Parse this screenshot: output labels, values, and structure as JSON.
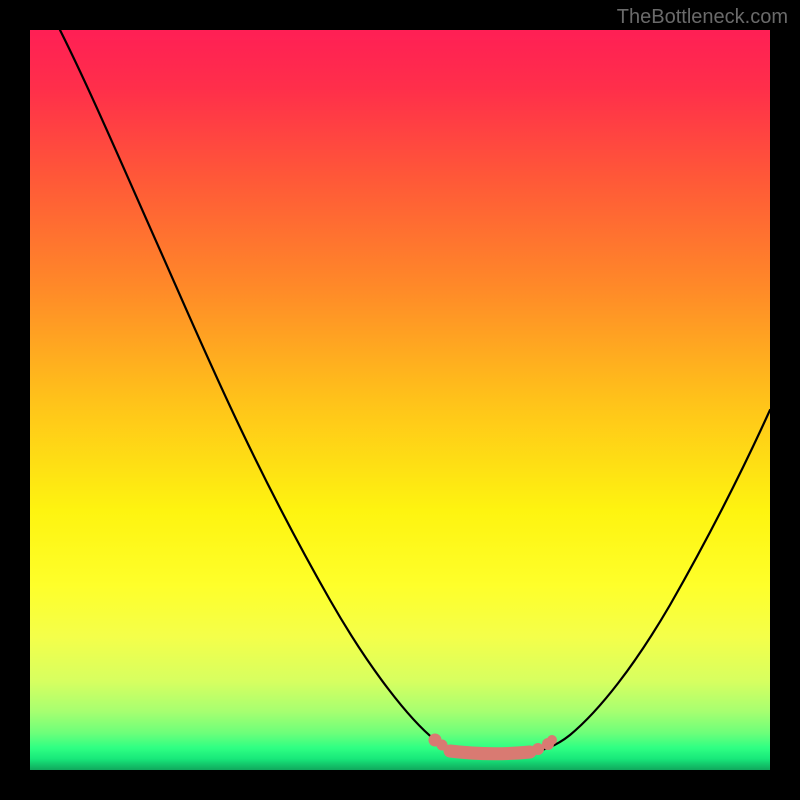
{
  "watermark": "TheBottleneck.com",
  "chart_data": {
    "type": "line",
    "title": "",
    "xlabel": "",
    "ylabel": "",
    "xlim": [
      0,
      100
    ],
    "ylim": [
      0,
      100
    ],
    "grid": false,
    "legend": false,
    "x": [
      4,
      10,
      20,
      30,
      40,
      48,
      52,
      55,
      58,
      60,
      63,
      67,
      72,
      77,
      80,
      85,
      90,
      95,
      100
    ],
    "values": [
      100,
      88,
      68,
      48,
      28,
      12,
      6,
      3,
      2,
      2,
      2,
      3,
      6,
      12,
      17,
      25,
      34,
      43,
      52
    ],
    "background_gradient_stops": [
      {
        "pos": 0,
        "color": "#ff1f55"
      },
      {
        "pos": 50,
        "color": "#ffc21a"
      },
      {
        "pos": 75,
        "color": "#feff2a"
      },
      {
        "pos": 100,
        "color": "#10a85c"
      }
    ],
    "highlight_range_x": [
      55,
      70
    ],
    "highlight_color": "#d97a72"
  }
}
